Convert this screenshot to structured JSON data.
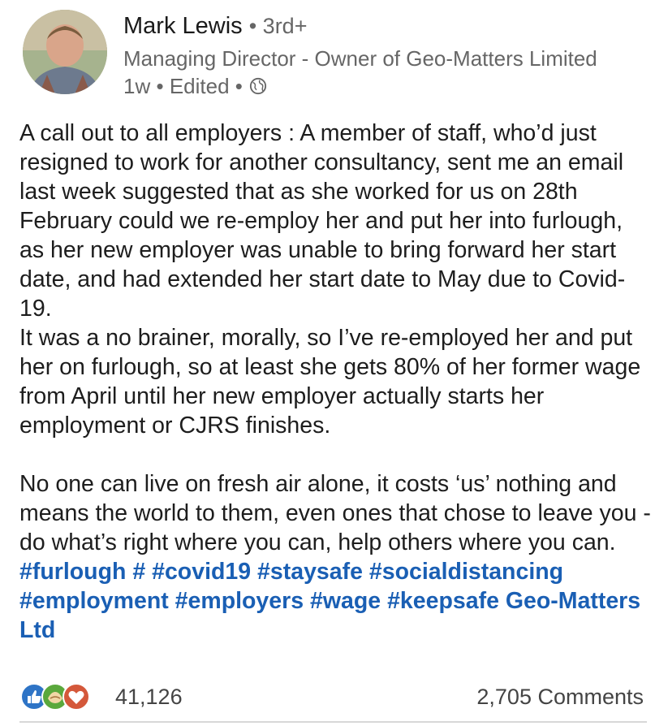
{
  "author": {
    "name": "Mark Lewis",
    "degree": "• 3rd+",
    "headline": "Managing Director - Owner of Geo-Matters Limited",
    "age": "1w",
    "separator": "•",
    "edited": "Edited",
    "separator2": "•",
    "visibility_icon": "globe-icon"
  },
  "post": {
    "p1_line1": "A call out to all employers : A member of staff, who’d just resigned to work for another consultancy, sent me an email last week suggested that as she worked for us on 28th February could we re-employ her and put her into furlough, as her new employer was unable to bring forward her start date, and had extended her start date to May due to Covid-19.",
    "p1_line2": "It was a no brainer, morally, so I’ve re-employed her and put her on furlough, so at least she gets 80% of her former wage from April until her new employer actually starts her employment or CJRS finishes.",
    "p2_text": "No one can live on fresh air alone, it costs ‘us’ nothing and means the world to them, even ones that chose to leave you - do what’s right where you can, help others where you can.",
    "hashtags": [
      "#furlough",
      "#",
      "#covid19",
      "#staysafe",
      "#socialdistancing",
      "#employment",
      "#employers",
      "#wage",
      "#keepsafe",
      "Geo-Matters Ltd"
    ]
  },
  "social": {
    "reaction_icons": [
      "like-icon",
      "celebrate-icon",
      "love-icon"
    ],
    "reaction_count": "41,126",
    "comments": "2,705 Comments"
  },
  "colors": {
    "hashtag": "#1a5fb4",
    "like": "#2e74c6",
    "celebrate": "#5aa83c",
    "love": "#d4583a"
  }
}
